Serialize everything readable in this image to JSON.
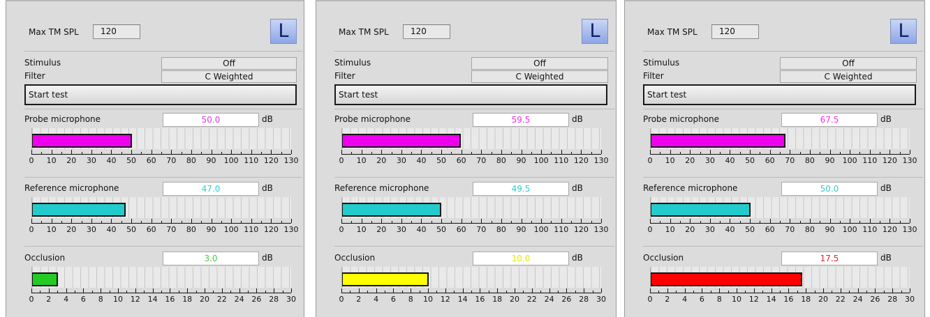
{
  "colors": {
    "probe": "#ee00ee",
    "reference": "#22cccc",
    "occlusion_green": "#22cc22",
    "occlusion_yellow": "#ffff00",
    "occlusion_red": "#ff0000",
    "probe_text": "#ee33ee",
    "reference_text": "#33cccc",
    "occlusion_text_green": "#44cc44",
    "occlusion_text_yellow": "#e8e800",
    "occlusion_text_red": "#ee2020"
  },
  "icon": "L-ear-icon",
  "panels": [
    {
      "max_label": "Max TM SPL",
      "max_value": "120",
      "l_label": "L",
      "stimulus_label": "Stimulus",
      "stimulus_value": "Off",
      "filter_label": "Filter",
      "filter_value": "C Weighted",
      "start_label": "Start test",
      "probe": {
        "label": "Probe microphone",
        "value": 50.0,
        "display": "50.0",
        "unit": "dB"
      },
      "reference": {
        "label": "Reference microphone",
        "value": 47.0,
        "display": "47.0",
        "unit": "dB"
      },
      "occlusion": {
        "label": "Occlusion",
        "value": 3.0,
        "display": "3.0",
        "unit": "dB",
        "color": "green"
      }
    },
    {
      "max_label": "Max TM SPL",
      "max_value": "120",
      "l_label": "L",
      "stimulus_label": "Stimulus",
      "stimulus_value": "Off",
      "filter_label": "Filter",
      "filter_value": "C Weighted",
      "start_label": "Start test",
      "probe": {
        "label": "Probe microphone",
        "value": 59.5,
        "display": "59.5",
        "unit": "dB"
      },
      "reference": {
        "label": "Reference microphone",
        "value": 49.5,
        "display": "49.5",
        "unit": "dB"
      },
      "occlusion": {
        "label": "Occlusion",
        "value": 10.0,
        "display": "10.0",
        "unit": "dB",
        "color": "yellow"
      }
    },
    {
      "max_label": "Max TM SPL",
      "max_value": "120",
      "l_label": "L",
      "stimulus_label": "Stimulus",
      "stimulus_value": "Off",
      "filter_label": "Filter",
      "filter_value": "C Weighted",
      "start_label": "Start test",
      "probe": {
        "label": "Probe microphone",
        "value": 67.5,
        "display": "67.5",
        "unit": "dB"
      },
      "reference": {
        "label": "Reference microphone",
        "value": 50.0,
        "display": "50.0",
        "unit": "dB"
      },
      "occlusion": {
        "label": "Occlusion",
        "value": 17.5,
        "display": "17.5",
        "unit": "dB",
        "color": "red"
      }
    }
  ],
  "scales": {
    "spl": {
      "min": 0,
      "max": 130,
      "labels": [
        "0",
        "10",
        "20",
        "30",
        "40",
        "50",
        "60",
        "70",
        "80",
        "90",
        "100",
        "110",
        "120",
        "130"
      ]
    },
    "occlusion": {
      "min": 0,
      "max": 30,
      "labels": [
        "0",
        "2",
        "4",
        "6",
        "8",
        "10",
        "12",
        "14",
        "16",
        "18",
        "20",
        "22",
        "24",
        "26",
        "28",
        "30"
      ]
    }
  }
}
